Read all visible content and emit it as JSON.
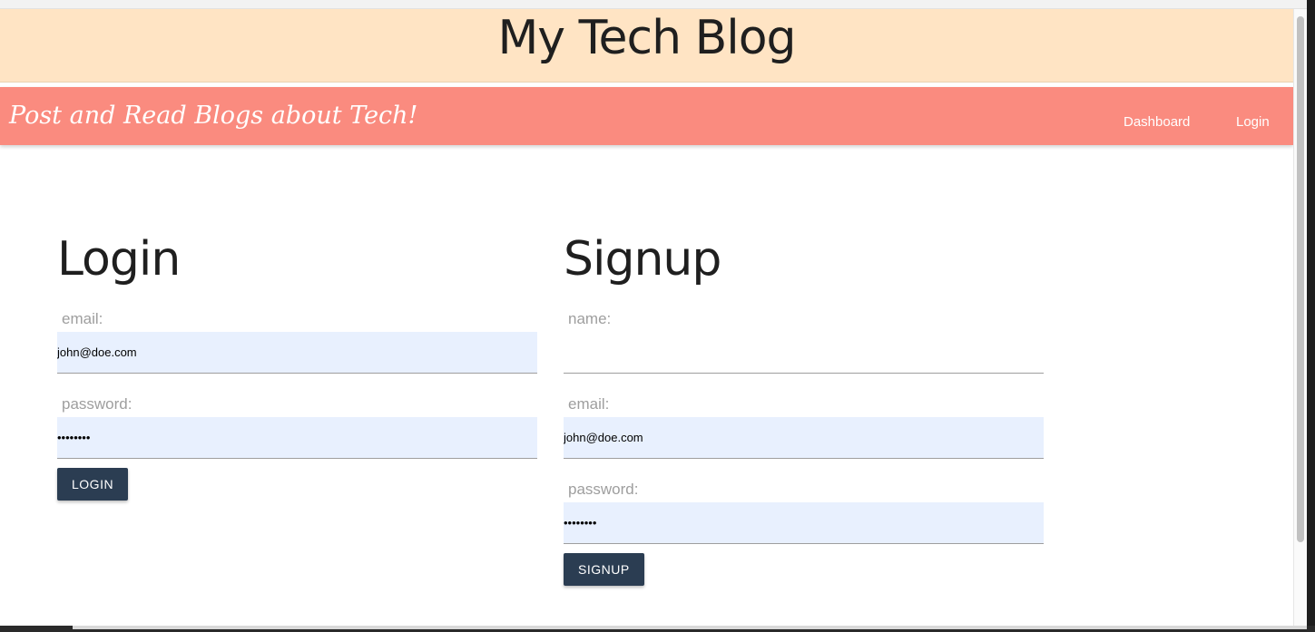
{
  "header": {
    "title": "My Tech Blog"
  },
  "navbar": {
    "tagline": "Post and Read Blogs about Tech!",
    "links": [
      {
        "label": "Dashboard"
      },
      {
        "label": "Login"
      }
    ]
  },
  "login": {
    "heading": "Login",
    "email_label": "email:",
    "email_value": "john@doe.com",
    "password_label": "password:",
    "password_value": "password",
    "button_label": "LOGIN"
  },
  "signup": {
    "heading": "Signup",
    "name_label": "name:",
    "name_value": "",
    "email_label": "email:",
    "email_value": "john@doe.com",
    "password_label": "password:",
    "password_value": "password",
    "button_label": "SIGNUP"
  },
  "colors": {
    "header_bg": "#ffe4c4",
    "navbar_bg": "#fa8b7f",
    "button_bg": "#2b3d52",
    "autofill_bg": "#e8f0fe"
  }
}
